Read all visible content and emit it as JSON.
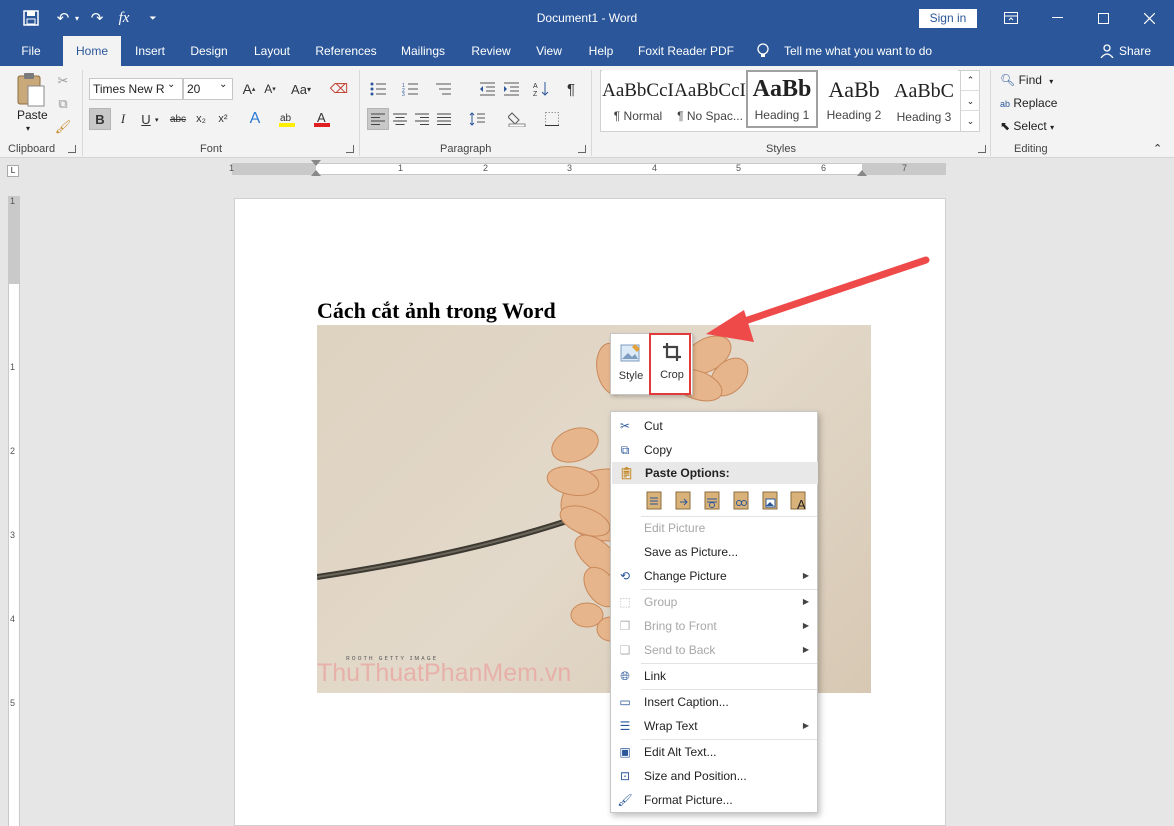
{
  "window": {
    "title": "Document1  -  Word",
    "sign_in": "Sign in"
  },
  "tabs": [
    "File",
    "Home",
    "Insert",
    "Design",
    "Layout",
    "References",
    "Mailings",
    "Review",
    "View",
    "Help",
    "Foxit Reader PDF"
  ],
  "tell_me": "Tell me what you want to do",
  "share": "Share",
  "ribbon": {
    "clipboard": {
      "label": "Clipboard",
      "paste": "Paste"
    },
    "font": {
      "label": "Font",
      "name": "Times New R",
      "size": "20",
      "bold": "B",
      "italic": "I",
      "underline": "U",
      "strike": "abc",
      "sub": "x₂",
      "sup": "x²",
      "change_case": "Aa"
    },
    "paragraph": {
      "label": "Paragraph"
    },
    "styles": {
      "label": "Styles",
      "items": [
        {
          "preview": "AaBbCcI",
          "name": "¶ Normal"
        },
        {
          "preview": "AaBbCcI",
          "name": "¶ No Spac..."
        },
        {
          "preview": "AaBb",
          "name": "Heading 1"
        },
        {
          "preview": "AaBb",
          "name": "Heading 2"
        },
        {
          "preview": "AaBbC",
          "name": "Heading 3"
        }
      ]
    },
    "editing": {
      "label": "Editing",
      "find": "Find",
      "replace": "Replace",
      "select": "Select"
    }
  },
  "ruler": {
    "h_numbers": [
      "1",
      "1",
      "2",
      "3",
      "4",
      "5",
      "6",
      "7"
    ],
    "v_numbers": [
      "1",
      "1",
      "2",
      "3",
      "4",
      "5"
    ]
  },
  "document": {
    "heading": "Cách cắt ảnh trong Word",
    "watermark": "ThuThuatPhanMem.vn",
    "image_caption": "ʀᴏᴏᴛʜ ɢᴇᴛᴛʏ ɪᴍᴀɢᴇ"
  },
  "mini_toolbar": {
    "style": "Style",
    "crop": "Crop"
  },
  "context_menu": {
    "cut": "Cut",
    "copy": "Copy",
    "paste_options": "Paste Options:",
    "edit_picture": "Edit Picture",
    "save_as_picture": "Save as Picture...",
    "change_picture": "Change Picture",
    "group": "Group",
    "bring_to_front": "Bring to Front",
    "send_to_back": "Send to Back",
    "link": "Link",
    "insert_caption": "Insert Caption...",
    "wrap_text": "Wrap Text",
    "edit_alt_text": "Edit Alt Text...",
    "size_and_position": "Size and Position...",
    "format_picture": "Format Picture..."
  },
  "colors": {
    "accent": "#2b579a",
    "highlight": "#e03a3a"
  }
}
